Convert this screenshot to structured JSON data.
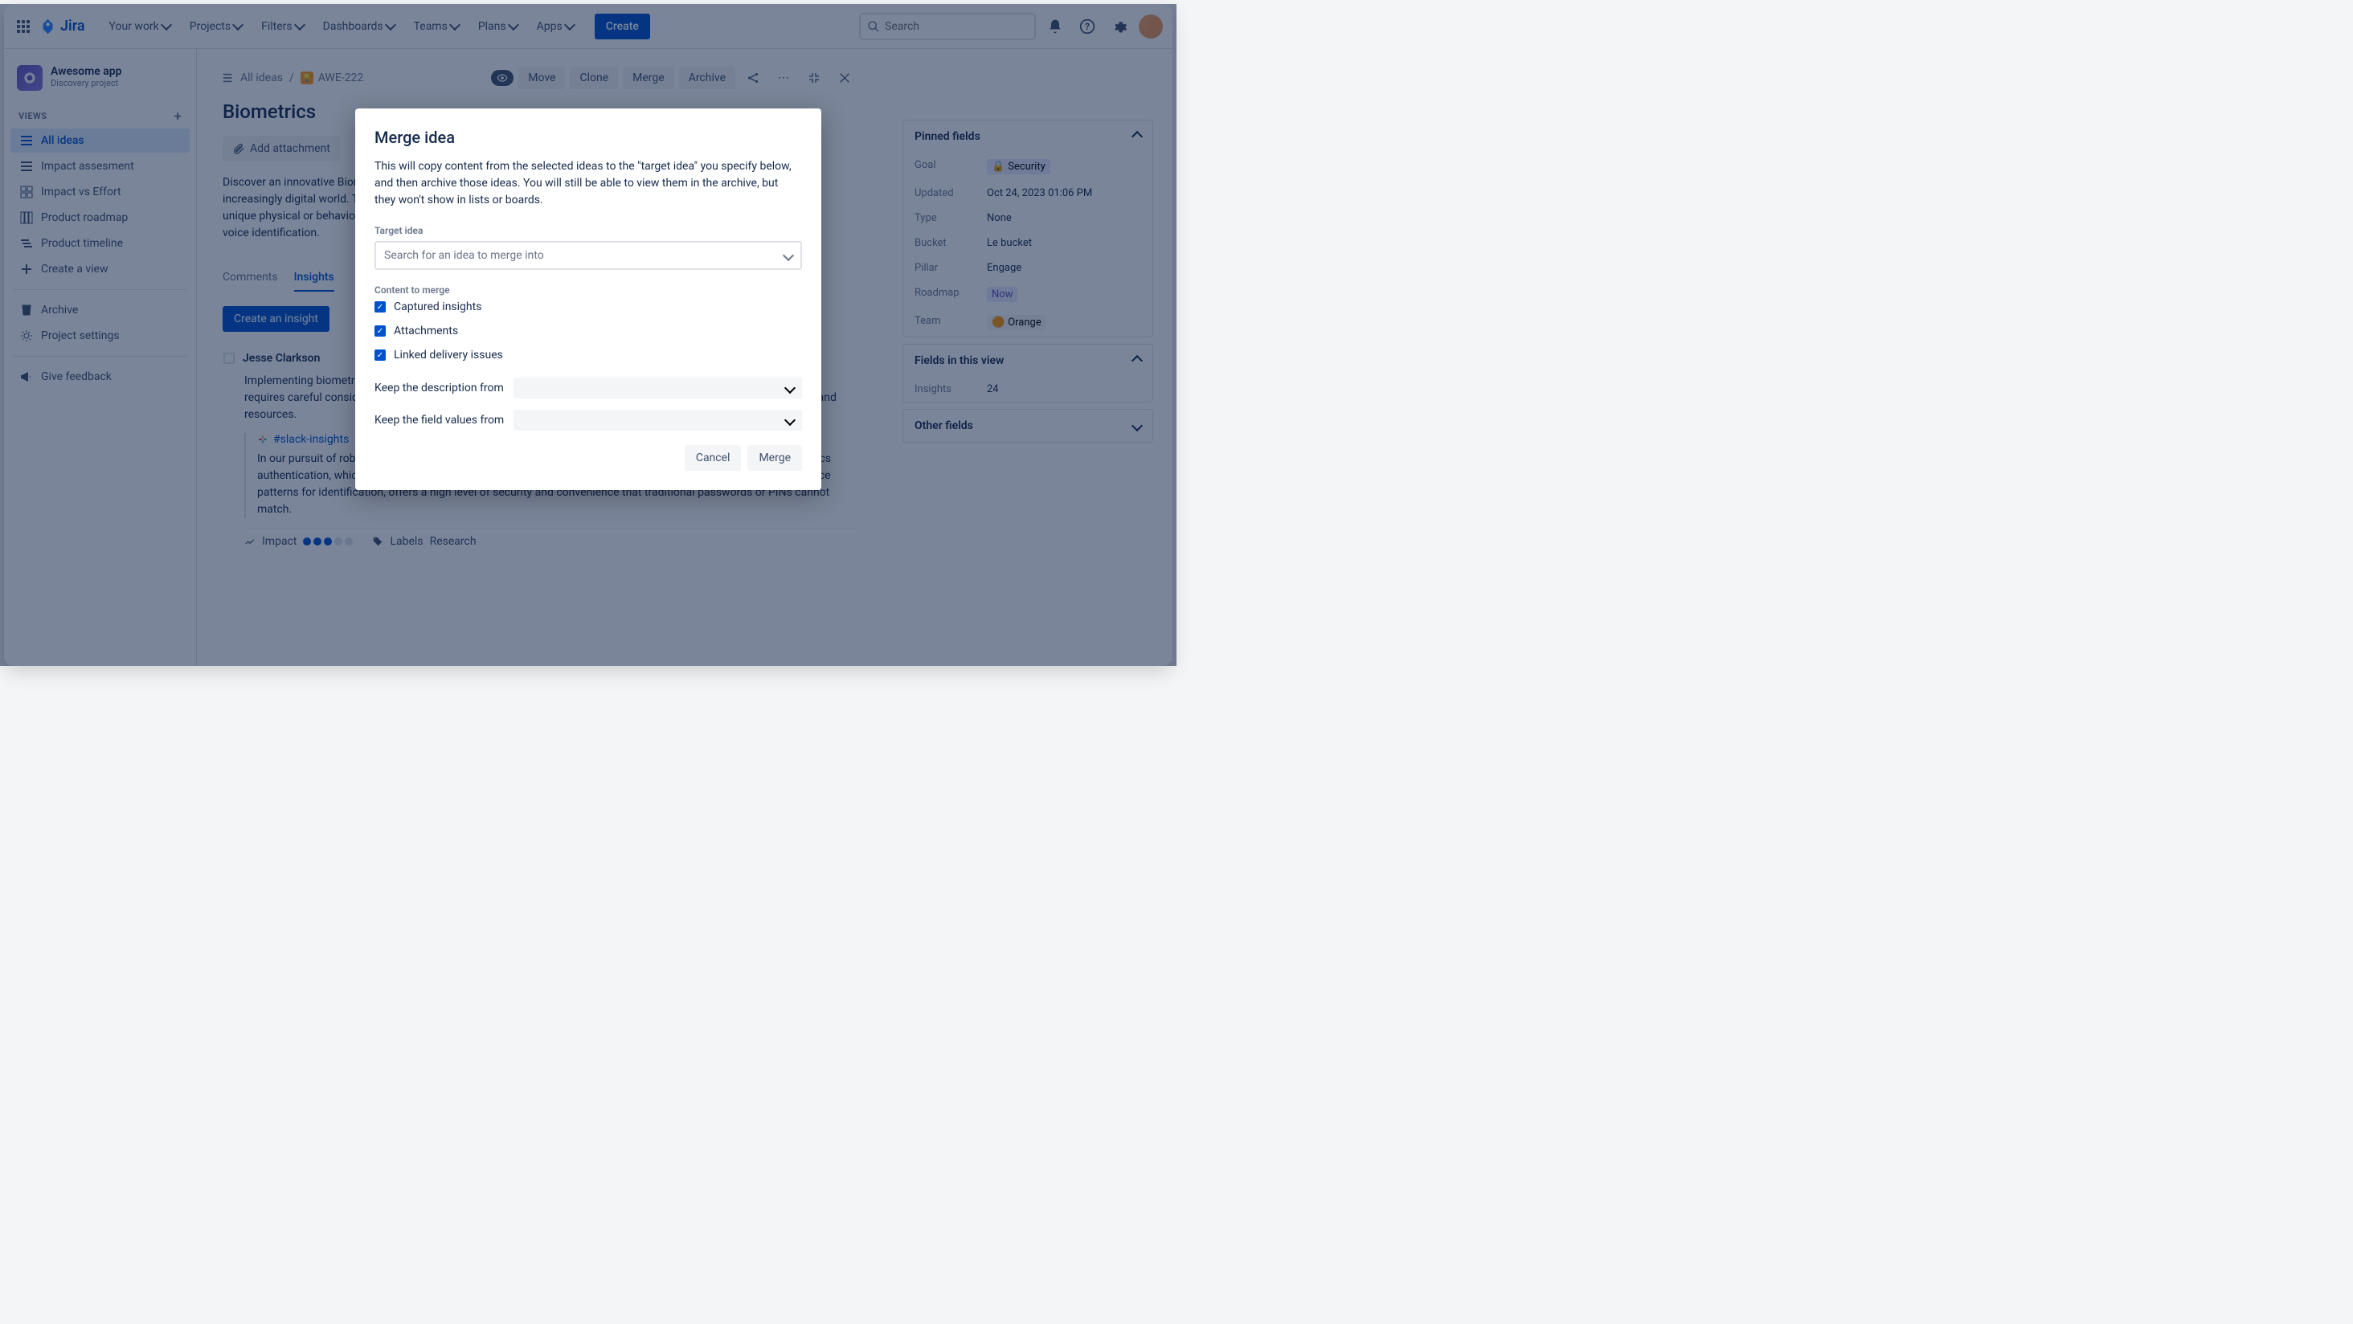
{
  "topnav": {
    "logo": "Jira",
    "items": [
      "Your work",
      "Projects",
      "Filters",
      "Dashboards",
      "Teams",
      "Plans",
      "Apps"
    ],
    "create": "Create",
    "search_placeholder": "Search"
  },
  "sidebar": {
    "project_name": "Awesome app",
    "project_type": "Discovery project",
    "views_label": "VIEWS",
    "views": [
      {
        "label": "All ideas",
        "active": true
      },
      {
        "label": "Impact assesment"
      },
      {
        "label": "Impact vs Effort"
      },
      {
        "label": "Product roadmap"
      },
      {
        "label": "Product timeline"
      }
    ],
    "create_view": "Create a view",
    "archive": "Archive",
    "project_settings": "Project settings",
    "give_feedback": "Give feedback"
  },
  "breadcrumb": {
    "all_ideas": "All ideas",
    "issue_key": "AWE-222"
  },
  "actions": {
    "move": "Move",
    "clone": "Clone",
    "merge": "Merge",
    "archive": "Archive"
  },
  "page": {
    "title": "Biometrics",
    "add_attachment": "Add attachment",
    "description": "Discover an innovative Biometrics Authentication App, your advanced solution for secure identity verification in our increasingly digital world. This cutting-edge application is designed to authenticate and verify individuals based on unique physical or behavioral characteristics, including fingerprint recognition, facial recognition, iris recognition, voice identification."
  },
  "tabs": {
    "comments": "Comments",
    "insights": "Insights"
  },
  "create_insight": "Create an insight",
  "insight": {
    "author": "Jesse Clarkson",
    "body": "Implementing biometrics authentication promises enhanced security and user convenience. As promising as it is, it requires careful considerations in terms of security, privacy, and integration. I believe it warrants further exploration and resources.",
    "slack_link": "#slack-insights",
    "quote": "In our pursuit of robust security measures, it's vital we examine the avenue of biometrics authentication. Biometrics authentication, which uses unique physical or behavioral attributes like fingerprints, facial recognition, or even voice patterns for identification, offers a high level of security and convenience that traditional passwords or PINs cannot match.",
    "impact_label": "Impact",
    "labels_label": "Labels",
    "label_value": "Research"
  },
  "panel": {
    "pinned_title": "Pinned fields",
    "fields": {
      "goal": {
        "label": "Goal",
        "value": "Security"
      },
      "updated": {
        "label": "Updated",
        "value": "Oct 24, 2023 01:06 PM"
      },
      "type": {
        "label": "Type",
        "value": "None"
      },
      "bucket": {
        "label": "Bucket",
        "value": "Le bucket"
      },
      "pillar": {
        "label": "Pillar",
        "value": "Engage"
      },
      "roadmap": {
        "label": "Roadmap",
        "value": "Now"
      },
      "team": {
        "label": "Team",
        "value": "Orange"
      }
    },
    "view_title": "Fields in this view",
    "insights_label": "Insights",
    "insights_value": "24",
    "other_title": "Other fields"
  },
  "modal": {
    "title": "Merge idea",
    "description": "This will copy content from the selected ideas to the \"target idea\" you specify below, and then archive those ideas. You will still be able to view them in the archive, but they won't show in lists or boards.",
    "target_label": "Target idea",
    "target_placeholder": "Search for an idea to merge into",
    "content_label": "Content to merge",
    "checks": [
      "Captured insights",
      "Attachments",
      "Linked delivery issues"
    ],
    "keep_desc": "Keep the description from",
    "keep_fields": "Keep the field values from",
    "cancel": "Cancel",
    "merge": "Merge"
  }
}
